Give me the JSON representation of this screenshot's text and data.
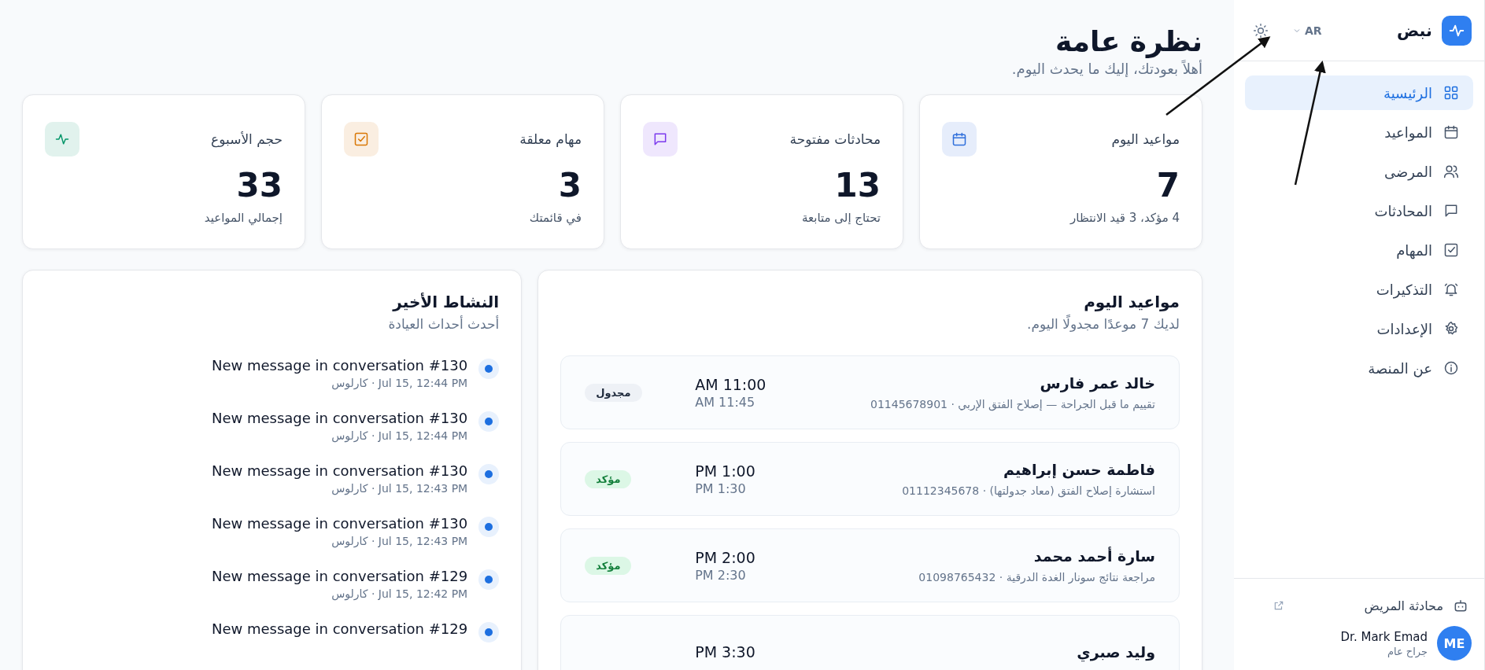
{
  "sidebar": {
    "brand": "نبض",
    "language": "AR",
    "nav": [
      {
        "label": "الرئيسية",
        "selected": true
      },
      {
        "label": "المواعيد",
        "selected": false
      },
      {
        "label": "المرضى",
        "selected": false
      },
      {
        "label": "المحادثات",
        "selected": false
      },
      {
        "label": "المهام",
        "selected": false
      },
      {
        "label": "التذكيرات",
        "selected": false
      },
      {
        "label": "الإعدادات",
        "selected": false
      },
      {
        "label": "عن المنصة",
        "selected": false
      }
    ],
    "patient_chat": "محادثة المريض",
    "user": {
      "initials": "ME",
      "name": "Dr. Mark Emad",
      "role": "جراح عام"
    }
  },
  "header": {
    "title": "نظرة عامة",
    "subtitle": "أهلاً بعودتك، إليك ما يحدث اليوم."
  },
  "stats": [
    {
      "label": "مواعيد اليوم",
      "value": "7",
      "caption": "4 مؤكد، 3 قيد الانتظار",
      "color": "#2f6fdb"
    },
    {
      "label": "محادثات مفتوحة",
      "value": "13",
      "caption": "تحتاج إلى متابعة",
      "color": "#7c3aed"
    },
    {
      "label": "مهام معلقة",
      "value": "3",
      "caption": "في قائمتك",
      "color": "#d97706"
    },
    {
      "label": "حجم الأسبوع",
      "value": "33",
      "caption": "إجمالي المواعيد",
      "color": "#059669"
    }
  ],
  "appointments": {
    "title": "مواعيد اليوم",
    "subtitle": "لديك 7 موعدًا مجدولًا اليوم.",
    "rows": [
      {
        "name": "خالد عمر فارس",
        "details": "تقييم ما قبل الجراحة — إصلاح الفتق الإربي · 01145678901",
        "start": "AM 11:00",
        "end": "AM 11:45",
        "status": {
          "kind": "scheduled",
          "label": "مجدول"
        }
      },
      {
        "name": "فاطمة حسن إبراهيم",
        "details": "استشارة إصلاح الفتق (معاد جدولتها) · 01112345678",
        "start": "PM 1:00",
        "end": "PM 1:30",
        "status": {
          "kind": "confirmed",
          "label": "مؤكد"
        }
      },
      {
        "name": "سارة أحمد محمد",
        "details": "مراجعة نتائج سونار الغدة الدرقية · 01098765432",
        "start": "PM 2:00",
        "end": "PM 2:30",
        "status": {
          "kind": "confirmed",
          "label": "مؤكد"
        }
      },
      {
        "name": "وليد صبري",
        "start": "PM 3:30"
      }
    ]
  },
  "activity": {
    "title": "النشاط الأخير",
    "subtitle": "أحدث أحداث العيادة",
    "items": [
      {
        "title": "New message in conversation #130",
        "meta": "Jul 15, 12:44 PM · كارلوس"
      },
      {
        "title": "New message in conversation #130",
        "meta": "Jul 15, 12:44 PM · كارلوس"
      },
      {
        "title": "New message in conversation #130",
        "meta": "Jul 15, 12:43 PM · كارلوس"
      },
      {
        "title": "New message in conversation #130",
        "meta": "Jul 15, 12:43 PM · كارلوس"
      },
      {
        "title": "New message in conversation #129",
        "meta": "Jul 15, 12:42 PM · كارلوس"
      },
      {
        "title": "New message in conversation #129"
      }
    ]
  }
}
